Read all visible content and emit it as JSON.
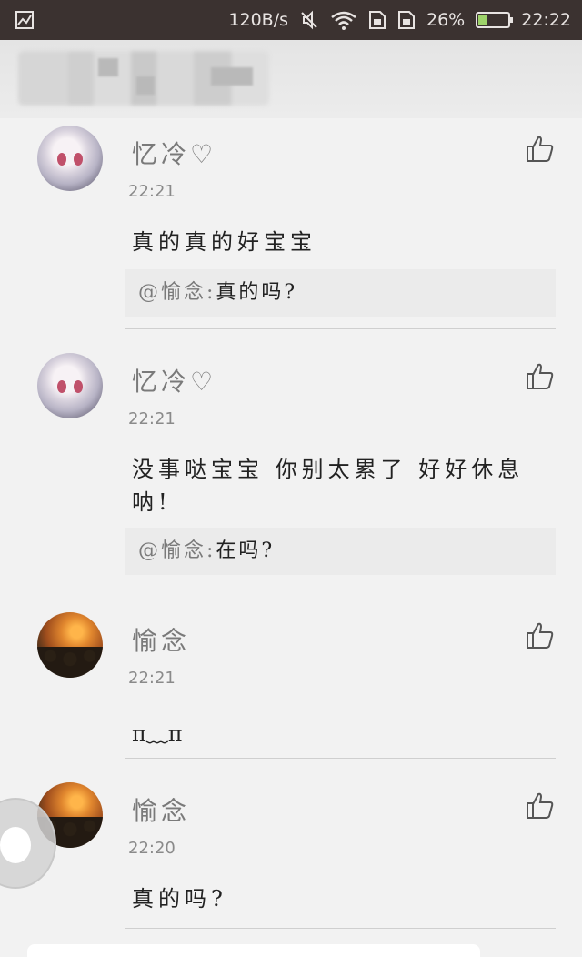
{
  "status_bar": {
    "network_speed": "120B/s",
    "battery_percent": "26%",
    "battery_level": 0.26,
    "time": "22:22",
    "icons": [
      "image-icon",
      "mute-icon",
      "wifi-icon",
      "sim1-icon",
      "sim2-icon",
      "battery-icon"
    ]
  },
  "comments": [
    {
      "username": "忆冷♡",
      "time": "22:21",
      "text": "真的真的好宝宝",
      "reply_mention": "@愉念:",
      "reply_quote": "真的吗?",
      "avatar": "anime-avatar"
    },
    {
      "username": "忆冷♡",
      "time": "22:21",
      "text": "没事哒宝宝 你别太累了 好好休息呐!",
      "reply_mention": "@愉念:",
      "reply_quote": "在吗?",
      "avatar": "anime-avatar"
    },
    {
      "username": "愉念",
      "time": "22:21",
      "text": "π﹏π",
      "avatar": "sunset-avatar"
    },
    {
      "username": "愉念",
      "time": "22:20",
      "text": "真的吗?",
      "avatar": "sunset-avatar"
    }
  ],
  "colors": {
    "status_bar_bg": "#3b3230",
    "page_bg": "#f2f2f2",
    "battery_fill": "#9ed36a"
  }
}
